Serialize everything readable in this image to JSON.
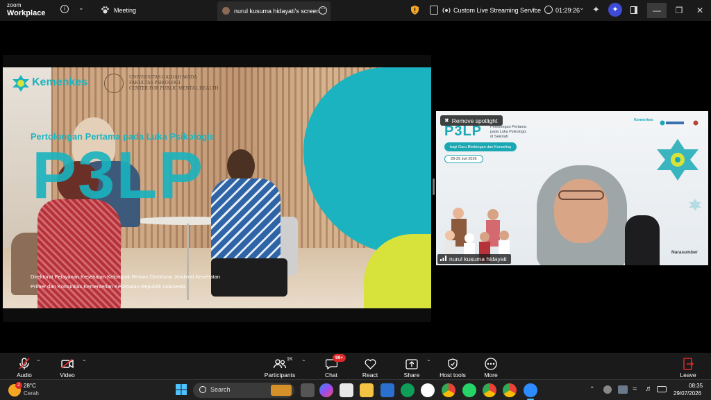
{
  "topbar": {
    "brand_line1": "zoom",
    "brand_line2": "Workplace",
    "meeting_label": "Meeting",
    "screen_tab_label": "nurul kusuma hidayati's screen",
    "streaming_label": "Custom Live Streaming Service",
    "timer": "01:29:26"
  },
  "slide": {
    "logo_kemenkes": "Kemenkes",
    "ugm_line1": "UNIVERSITAS GADJAH MADA",
    "ugm_line2": "FAKULTAS PSIKOLOGI",
    "ugm_line3": "CENTER FOR PUBLIC MENTAL HEALTH",
    "subtitle": "Pertolongan Pertama pada Luka Psikologis",
    "big_title": "P3LP",
    "footer_line1": "Direktorat Pelayanan Kesehatan Kelompok Rentan Direktorat Jenderal Kesehatan",
    "footer_line2": "Primer dan Komunitas Kementerian Kesehatan Republik Indonesia"
  },
  "tile": {
    "spotlight_button": "Remove spotlight",
    "title": "P3LP",
    "title_desc_1": "Pertolongan Pertama",
    "title_desc_2": "pada Luka Psikologis",
    "title_desc_3": "di Sekolah",
    "audience": "bagi Guru Bimbingan dan Konseling",
    "dates": "28-29 Juli 2026",
    "logos": "Kemenkes",
    "role": "Narasumber",
    "participant_name": "nurul kusuma hidayati"
  },
  "toolbar": {
    "audio": "Audio",
    "video": "Video",
    "participants": "Participants",
    "participants_count": "1K",
    "chat": "Chat",
    "chat_badge": "99+",
    "react": "React",
    "share": "Share",
    "host_tools": "Host tools",
    "more": "More",
    "leave": "Leave"
  },
  "taskbar": {
    "weather_temp": "28°C",
    "weather_desc": "Cerah",
    "weather_badge": "2",
    "search_placeholder": "Search",
    "time": "08:35",
    "date": "29/07/2026"
  },
  "colors": {
    "teal": "#1ab3bf",
    "yellow": "#d7e23a",
    "leave_red": "#e02828",
    "chat_badge": "#e02828"
  }
}
